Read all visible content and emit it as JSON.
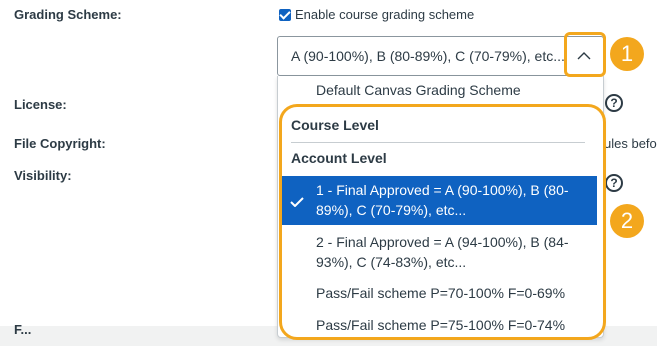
{
  "form": {
    "grading_scheme_label": "Grading Scheme:",
    "license_label": "License:",
    "file_copyright_label": "File Copyright:",
    "visibility_label": "Visibility:",
    "bottom_label": "F..."
  },
  "grading_scheme": {
    "checkbox_label": "Enable course grading scheme",
    "checked": true,
    "selected_value": "A (90-100%), B (80-89%), C (70-79%), etc...",
    "expanded": true
  },
  "dropdown": {
    "default_option": "Default Canvas Grading Scheme",
    "group_course": "Course Level",
    "group_account": "Account Level",
    "options": [
      {
        "label": "1 - Final Approved = A (90-100%), B (80-89%), C (70-79%), etc...",
        "selected": true
      },
      {
        "label": "2 - Final Approved = A (94-100%), B (84-93%), C (74-83%), etc...",
        "selected": false
      },
      {
        "label": "Pass/Fail scheme P=70-100% F=0-69%",
        "selected": false
      },
      {
        "label": "Pass/Fail scheme P=75-100% F=0-74%",
        "selected": false
      }
    ]
  },
  "background_text": {
    "copyright_clipped": "ules befor"
  },
  "help_icons": {
    "glyph": "?"
  },
  "callouts": {
    "badge_1": "1",
    "badge_2": "2",
    "color": "#f3a71d"
  },
  "colors": {
    "accent": "#0f62c1",
    "text": "#2d3b45"
  }
}
